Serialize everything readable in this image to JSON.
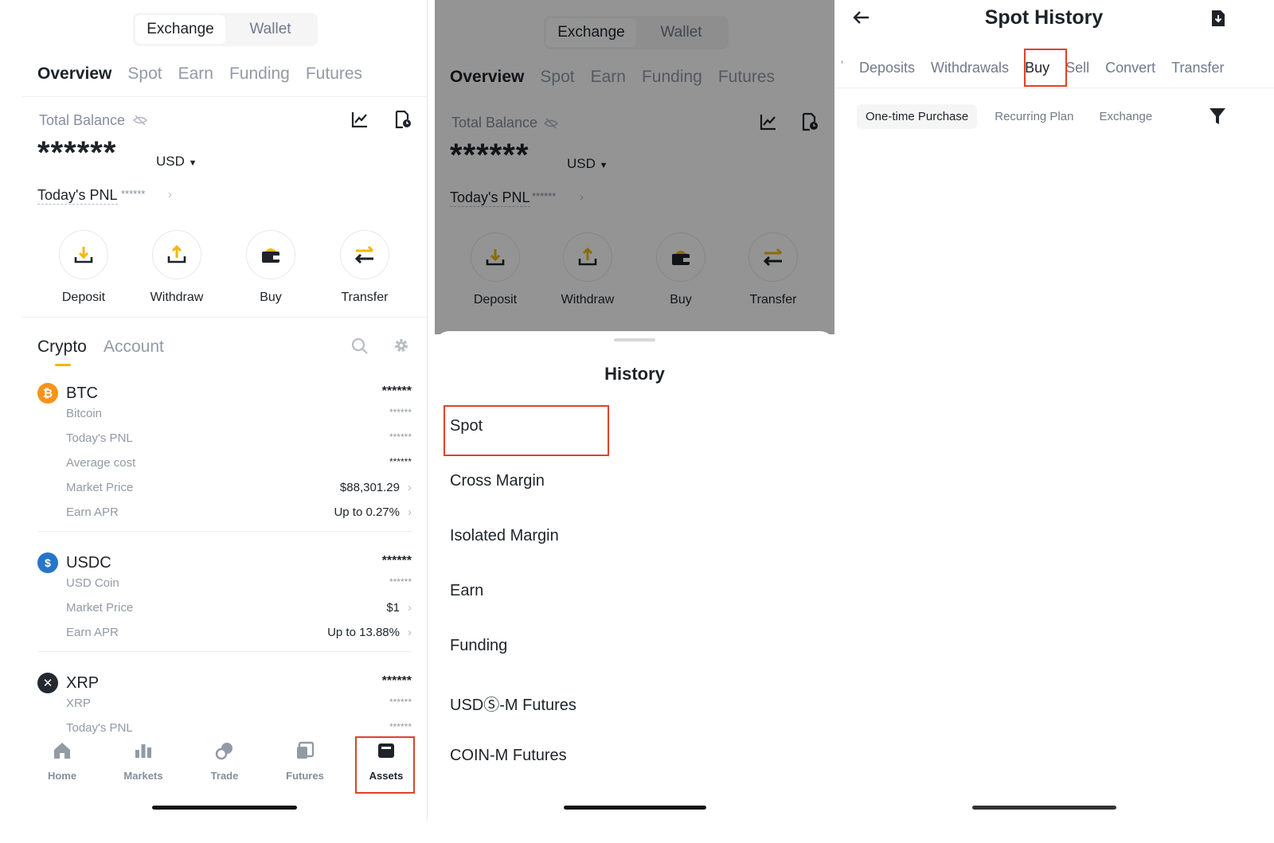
{
  "colors": {
    "accent": "#f0b90b",
    "highlight": "#e0412c",
    "btc": "#f7931a",
    "usdc": "#2775ca",
    "xrp": "#23292f"
  },
  "panel1": {
    "toggle": [
      "Exchange",
      "Wallet"
    ],
    "tabs": [
      "Overview",
      "Spot",
      "Earn",
      "Funding",
      "Futures"
    ],
    "total_balance_label": "Total Balance",
    "balance": "******",
    "currency": "USD",
    "pnl_label": "Today's PNL",
    "pnl_value": "******",
    "actions": [
      "Deposit",
      "Withdraw",
      "Buy",
      "Transfer"
    ],
    "section_tabs": [
      "Crypto",
      "Account"
    ],
    "coins": {
      "btc": {
        "symbol": "BTC",
        "name": "Bitcoin",
        "amount": "******",
        "sub_amount": "******",
        "rows": [
          {
            "k": "Today's PNL",
            "v": "******"
          },
          {
            "k": "Average cost",
            "v": "******"
          },
          {
            "k": "Market Price",
            "v": "$88,301.29"
          },
          {
            "k": "Earn APR",
            "v": "Up to 0.27%"
          }
        ]
      },
      "usdc": {
        "symbol": "USDC",
        "name": "USD Coin",
        "amount": "******",
        "sub_amount": "******",
        "rows": [
          {
            "k": "Market Price",
            "v": "$1"
          },
          {
            "k": "Earn APR",
            "v": "Up to 13.88%"
          }
        ]
      },
      "xrp": {
        "symbol": "XRP",
        "name": "XRP",
        "amount": "******",
        "sub_amount": "******",
        "rows": [
          {
            "k": "Today's PNL",
            "v": "******"
          }
        ]
      }
    },
    "nav": [
      "Home",
      "Markets",
      "Trade",
      "Futures",
      "Assets"
    ]
  },
  "panel2": {
    "toggle": [
      "Exchange",
      "Wallet"
    ],
    "tabs": [
      "Overview",
      "Spot",
      "Earn",
      "Funding",
      "Futures"
    ],
    "total_balance_label": "Total Balance",
    "balance": "******",
    "currency": "USD",
    "pnl_label": "Today's PNL",
    "pnl_value": "******",
    "actions": [
      "Deposit",
      "Withdraw",
      "Buy",
      "Transfer"
    ],
    "sheet_title": "History",
    "history_items": [
      "Spot",
      "Cross Margin",
      "Isolated Margin",
      "Earn",
      "Funding",
      "USDⓈ-M Futures",
      "COIN-M Futures"
    ]
  },
  "panel3": {
    "title": "Spot History",
    "tabs": [
      "Deposits",
      "Withdrawals",
      "Buy",
      "Sell",
      "Convert",
      "Transfer"
    ],
    "subtabs": [
      "One-time Purchase",
      "Recurring Plan",
      "Exchange"
    ]
  }
}
